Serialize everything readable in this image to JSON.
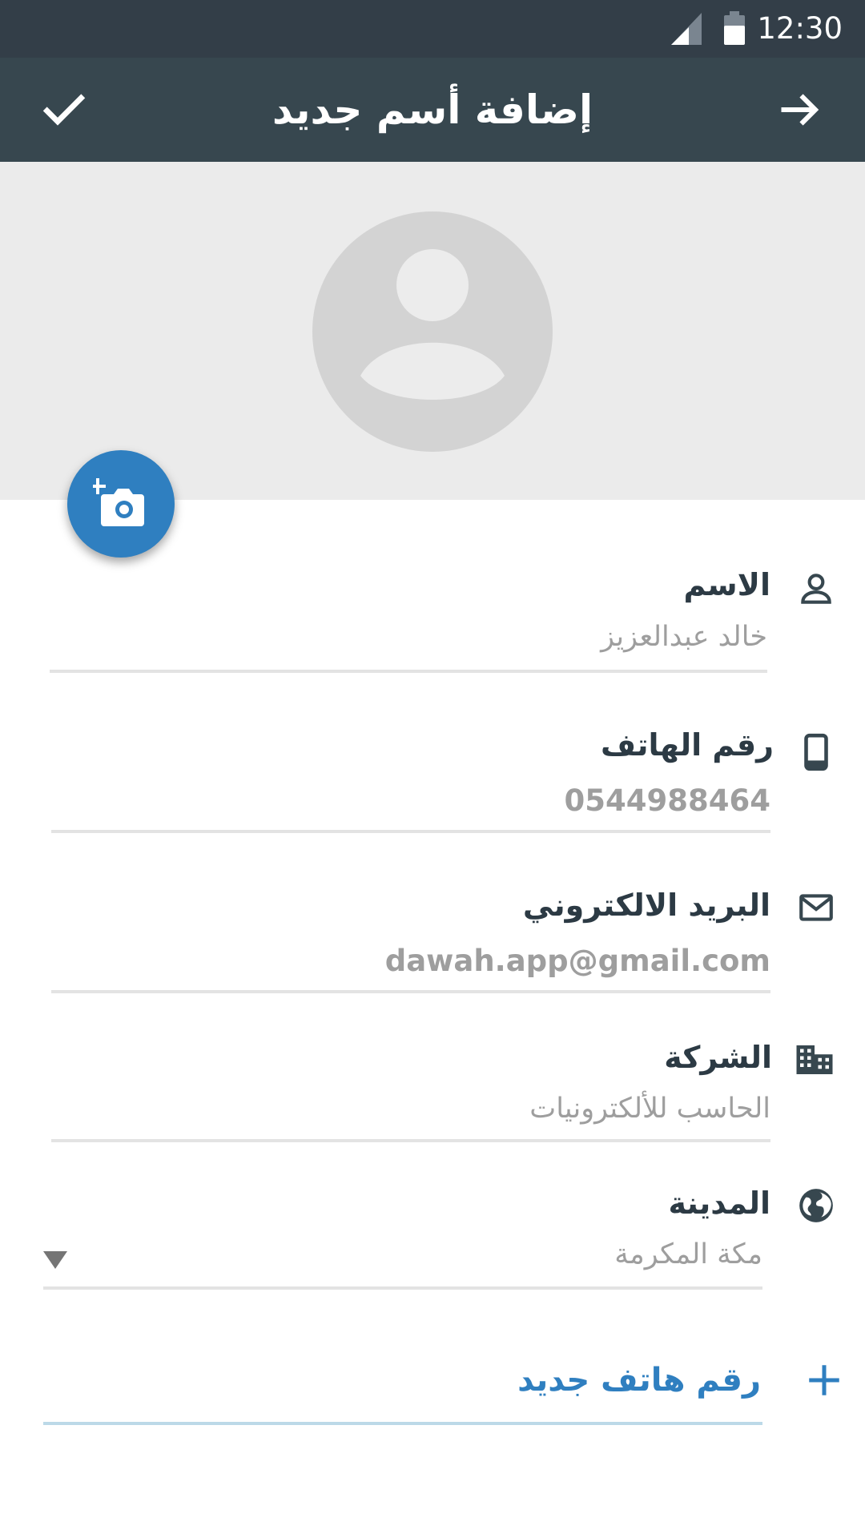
{
  "status_bar": {
    "time": "12:30",
    "icons": [
      "signal-icon",
      "battery-icon"
    ]
  },
  "app_bar": {
    "title": "إضافة أسم جديد",
    "confirm_icon": "check-icon",
    "back_icon": "arrow-forward-icon",
    "background": "#37474f"
  },
  "header": {
    "avatar_icon": "avatar-placeholder-icon",
    "add_photo_icon": "add-photo-camera-icon",
    "fab_color": "#2f7fc0"
  },
  "form": {
    "name": {
      "label": "الاسم",
      "value": "خالد عبدالعزيز",
      "icon": "person-icon"
    },
    "phone": {
      "label": "رقم الهاتف",
      "value": "0544988464",
      "icon": "phone-icon"
    },
    "email": {
      "label": "البريد الالكتروني",
      "value": "dawah.app@gmail.com",
      "icon": "mail-icon"
    },
    "company": {
      "label": "الشركة",
      "value": "الحاسب للألكترونيات",
      "icon": "building-icon"
    },
    "city": {
      "label": "المدينة",
      "value": "مكة المكرمة",
      "icon": "globe-icon"
    }
  },
  "add_phone": {
    "label": "رقم هاتف جديد",
    "icon": "plus-icon",
    "color": "#2f7fc0"
  }
}
